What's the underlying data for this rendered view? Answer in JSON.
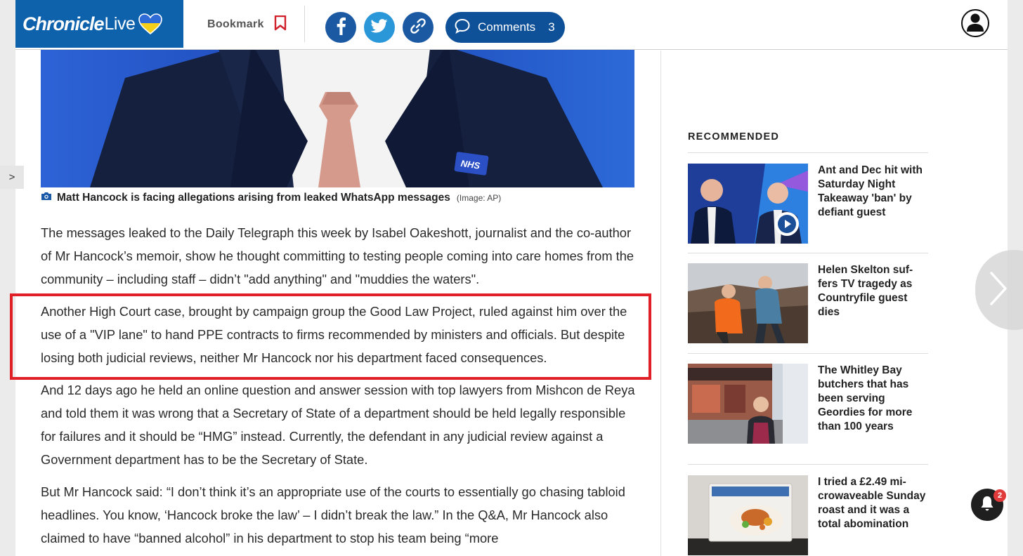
{
  "header": {
    "logo_main": "Chronicle",
    "logo_sub": "Live",
    "bookmark_label": "Bookmark",
    "comments_label": "Comments",
    "comments_count": "3",
    "icons": [
      "ukraine-heart-icon",
      "bookmark-icon",
      "facebook-icon",
      "twitter-icon",
      "link-icon",
      "comment-bubble-icon",
      "account-icon"
    ]
  },
  "left_tab": {
    "label": ">"
  },
  "article": {
    "caption": "Matt Hancock is facing allegations arising from leaked WhatsApp messages",
    "caption_credit": "(Image: AP)",
    "paragraphs": [
      "The messages leaked to the Daily Telegraph this week by Isabel Oakeshott, journalist and the co-author of Mr Hancock’s memoir, show he thought committing to testing people coming into care homes from the community – including staff – didn’t \"add anything\" and \"muddies the waters\".",
      "Another High Court case, brought by campaign group the Good Law Project, ruled against him over the use of a \"VIP lane\" to hand PPE contracts to firms recommended by ministers and officials. But despite losing both judicial reviews, neither Mr Hancock nor his department faced consequences.",
      "And 12 days ago he held an online question and answer session with top lawyers from Mishcon de Reya and told them it was wrong that a Secretary of State of a department should be held legally responsible for failures and it should be “HMG” instead. Currently, the defendant in any judicial review against a Government department has to be the Secretary of State.",
      "But Mr Hancock said: “I don’t think it’s an appropriate use of the courts to essentially go chasing tabloid headlines. You know, ‘Hancock broke the law’ – I didn’t break the law.” In the Q&A, Mr Hancock also claimed to have “banned alcohol” in his department to stop his team being “more"
    ]
  },
  "sidebar": {
    "title": "RECOMMENDED",
    "items": [
      {
        "headline": "Ant and Dec hit with Saturday Night Takeaway 'ban' by defiant guest",
        "has_video": true
      },
      {
        "headline": "Helen Skelton suf-fers TV tragedy as Countryfile guest dies",
        "has_video": false
      },
      {
        "headline": "The Whitley Bay butchers that has been serving Geordies for more than 100 years",
        "has_video": false
      },
      {
        "headline": "I tried a £2.49 mi-crowaveable Sunday roast and it was a total abomination",
        "has_video": false
      }
    ]
  },
  "notifications": {
    "badge": "2"
  },
  "colors": {
    "brand": "#0e62ac",
    "highlight": "#e01f26",
    "comments_pill": "#0e5199",
    "badge": "#e03a3a"
  }
}
